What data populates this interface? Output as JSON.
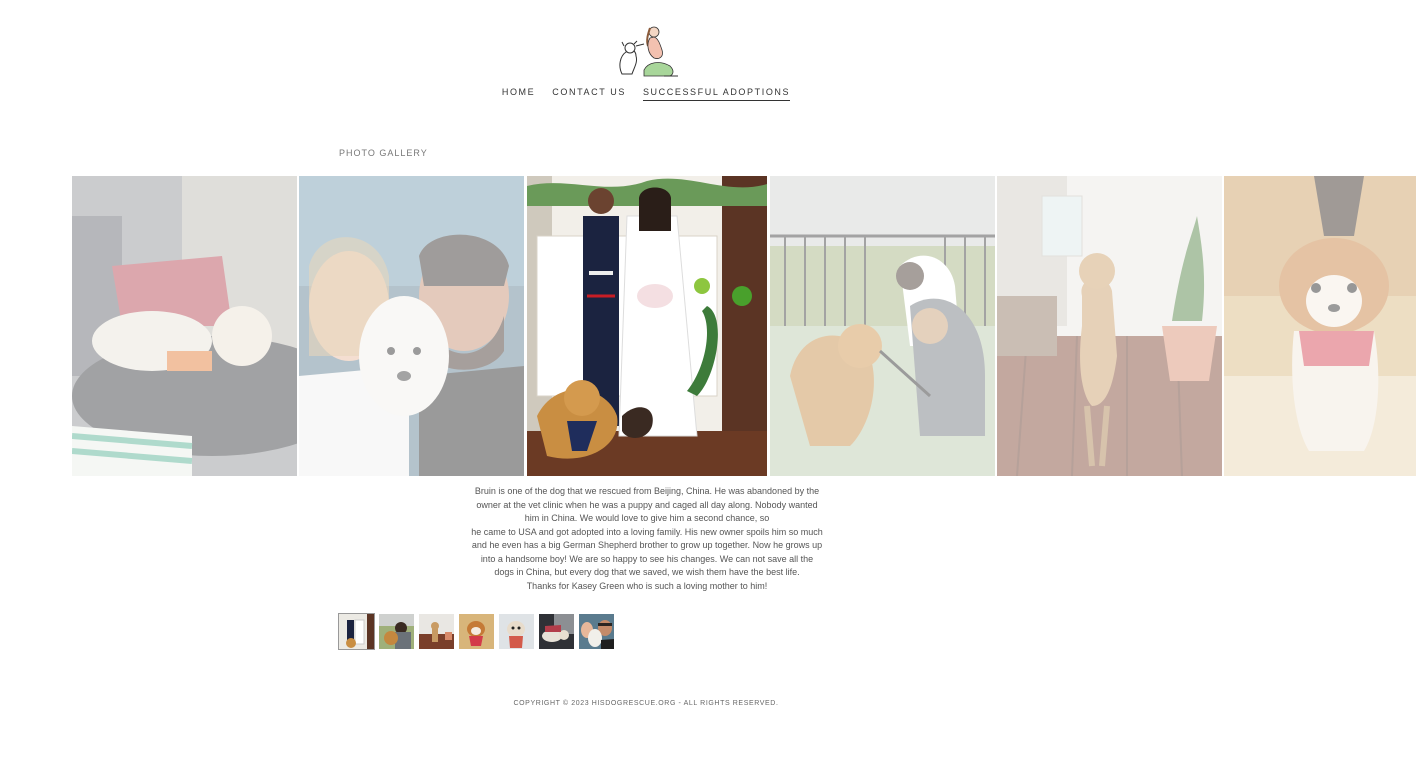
{
  "logo": {
    "icon": "dog-and-woman-logo"
  },
  "nav": {
    "items": [
      {
        "label": "HOME",
        "active": false
      },
      {
        "label": "CONTACT US",
        "active": false
      },
      {
        "label": "SUCCESSFUL ADOPTIONS",
        "active": true
      }
    ]
  },
  "gallery": {
    "title": "PHOTO GALLERY",
    "active_index": 2,
    "slides": [
      {
        "scene": "white curly dog sleeping on lap with orange vest"
      },
      {
        "scene": "couple selfie with white terrier"
      },
      {
        "scene": "wedding couple with golden dog at fireplace"
      },
      {
        "scene": "woman hugging golden retriever outdoors"
      },
      {
        "scene": "tan dog standing on wood floor"
      },
      {
        "scene": "fluffy small dog in red harness"
      }
    ],
    "caption": {
      "paragraph": "Bruin is one of the dog that we rescued from Beijing, China. He was abandoned by the owner at the vet clinic when he was a puppy and caged all day along.  Nobody wanted him in China. We would love to give him a second chance, so\nhe came to USA and got adopted into a loving family.  His new owner spoils him so much and he even has a big German Shepherd brother to grow up together.  Now he grows up into a handsome boy!  We are so happy to see his changes. We can not save all the dogs in China, but every dog that we saved, we wish them have the best life.",
      "thanks": "Thanks for Kasey Green who is such a loving mother to him!"
    },
    "thumbnails": [
      {
        "scene": "wedding"
      },
      {
        "scene": "golden dog hug"
      },
      {
        "scene": "tan dog floor"
      },
      {
        "scene": "small fluffy dog"
      },
      {
        "scene": "dog in harness"
      },
      {
        "scene": "sleeping curly dog"
      },
      {
        "scene": "couple selfie"
      }
    ]
  },
  "footer": {
    "text": "COPYRIGHT © 2023 HISDOGRESCUE.ORG - ALL RIGHTS RESERVED."
  },
  "colors": {
    "accent": "#333333",
    "background": "#ffffff",
    "caption_text": "#555555"
  }
}
